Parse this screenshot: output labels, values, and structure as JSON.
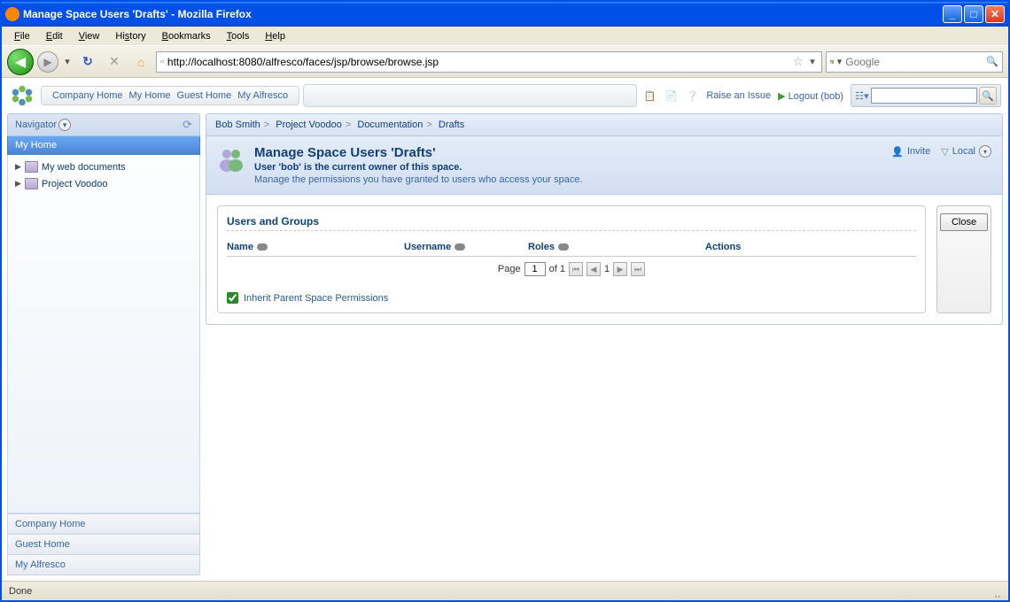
{
  "window": {
    "title": "Manage Space Users 'Drafts' - Mozilla Firefox"
  },
  "menubar": [
    "File",
    "Edit",
    "View",
    "History",
    "Bookmarks",
    "Tools",
    "Help"
  ],
  "toolbar": {
    "url": "http://localhost:8080/alfresco/faces/jsp/browse/browse.jsp",
    "search_placeholder": "Google"
  },
  "topnav": {
    "links": [
      "Company Home",
      "My Home",
      "Guest Home",
      "My Alfresco"
    ],
    "raise_issue": "Raise an Issue",
    "logout": "Logout (bob)"
  },
  "navigator": {
    "title": "Navigator",
    "selected": "My Home",
    "tree": [
      "My web documents",
      "Project Voodoo"
    ],
    "bottom": [
      "Company Home",
      "Guest Home",
      "My Alfresco"
    ]
  },
  "breadcrumb": [
    "Bob Smith",
    "Project Voodoo",
    "Documentation",
    "Drafts"
  ],
  "header": {
    "title": "Manage Space Users 'Drafts'",
    "owner": "User 'bob' is the current owner of this space.",
    "desc": "Manage the permissions you have granted to users who access your space.",
    "invite": "Invite",
    "local": "Local"
  },
  "panel": {
    "title": "Users and Groups",
    "columns": {
      "name": "Name",
      "username": "Username",
      "roles": "Roles",
      "actions": "Actions"
    },
    "pager": {
      "page_label": "Page",
      "current": "1",
      "of_label": "of 1",
      "num": "1"
    },
    "inherit": "Inherit Parent Space Permissions"
  },
  "close_label": "Close",
  "status": "Done"
}
